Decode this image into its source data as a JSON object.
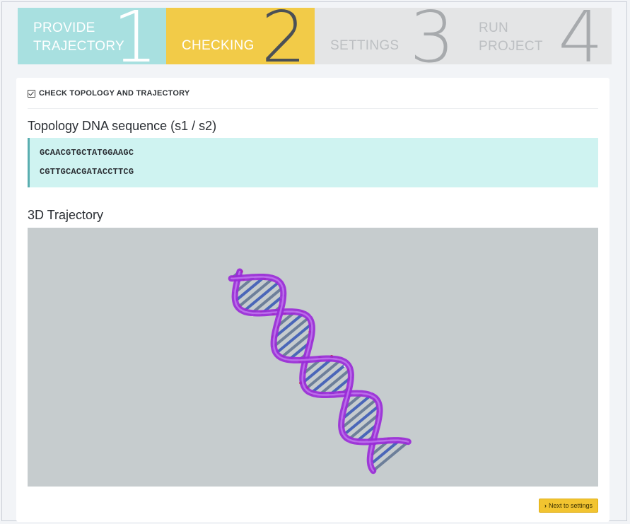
{
  "wizard": {
    "steps": [
      {
        "label": "PROVIDE\nTRAJECTORY",
        "number": "1",
        "state": "done"
      },
      {
        "label": "CHECKING",
        "number": "2",
        "state": "active"
      },
      {
        "label": "SETTINGS",
        "number": "3",
        "state": "inactive"
      },
      {
        "label": "RUN\nPROJECT",
        "number": "4",
        "state": "inactive"
      }
    ]
  },
  "panel": {
    "header": "CHECK TOPOLOGY AND TRAJECTORY",
    "topology_title": "Topology DNA sequence (s1 / s2)",
    "sequences": [
      "GCAACGTGCTATGGAAGC",
      "CGTTGCACGATACCTTCG"
    ],
    "trajectory_title": "3D Trajectory",
    "next_button": "Next to settings"
  },
  "colors": {
    "step_done": "#a8e0e0",
    "step_active": "#f2cb48",
    "step_inactive": "#e4e5e6",
    "sequence_bg": "#cff3f1",
    "viewer_bg": "#c6ccce",
    "button": "#f2c430",
    "dna_backbone": "#9a2bd8"
  },
  "icons": {
    "header_icon": "check-square-icon",
    "button_icon": "chevron-right-icon"
  }
}
